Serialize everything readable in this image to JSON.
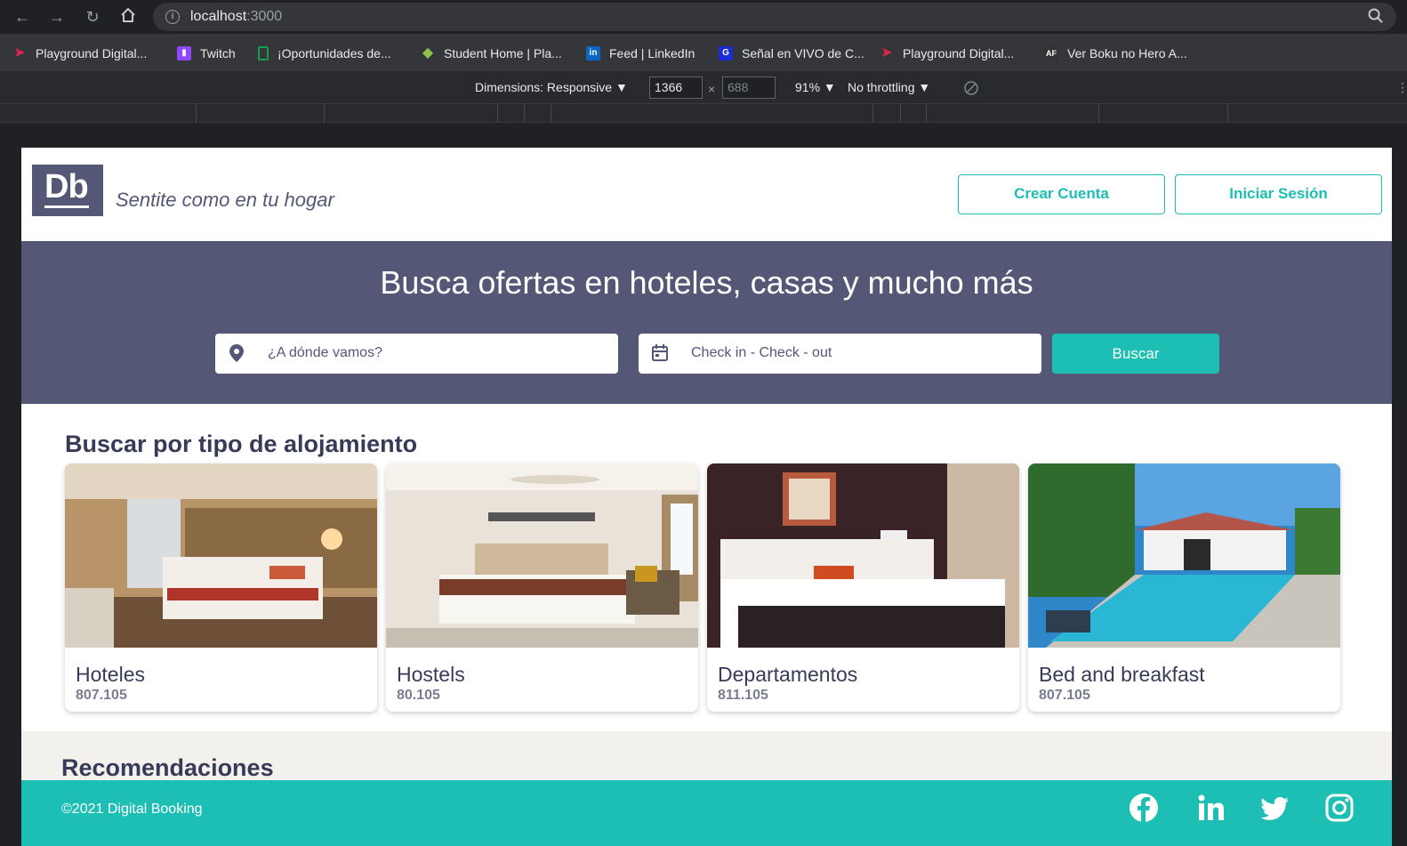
{
  "browser": {
    "url_host": "localhost",
    "url_port": ":3000",
    "bookmarks": [
      {
        "label": "Playground Digital...",
        "color": "#e0244b",
        "icon": "play-icon"
      },
      {
        "label": "Twitch",
        "color": "#9146ff",
        "icon": "twitch-icon"
      },
      {
        "label": "¡Oportunidades de...",
        "color": "#1a9b52",
        "icon": "doc-icon"
      },
      {
        "label": "Student Home | Pla...",
        "color": "#8bc34a",
        "icon": "diamond-icon"
      },
      {
        "label": "Feed | LinkedIn",
        "color": "#0a66c2",
        "icon": "linkedin-icon"
      },
      {
        "label": "Señal en VIVO de C...",
        "color": "#1c2bd6",
        "icon": "g-icon"
      },
      {
        "label": "Playground Digital...",
        "color": "#e0244b",
        "icon": "play-icon"
      },
      {
        "label": "Ver Boku no Hero A...",
        "color": "#333333",
        "icon": "af-icon"
      }
    ],
    "devtools": {
      "dimensions_label": "Dimensions: Responsive ▼",
      "width": "1366",
      "height": "688",
      "times": "×",
      "zoom": "91% ▼",
      "throttling": "No throttling ▼"
    }
  },
  "header": {
    "logo_text": "Db",
    "slogan": "Sentite como en tu hogar",
    "create_account": "Crear Cuenta",
    "login": "Iniciar Sesión"
  },
  "hero": {
    "title": "Busca ofertas en hoteles, casas y mucho más",
    "location_placeholder": "¿A dónde vamos?",
    "dates_placeholder": "Check in - Check - out",
    "search_button": "Buscar"
  },
  "categories": {
    "title": "Buscar por tipo de alojamiento",
    "items": [
      {
        "name": "Hoteles",
        "count": "807.105"
      },
      {
        "name": "Hostels",
        "count": "80.105"
      },
      {
        "name": "Departamentos",
        "count": "811.105"
      },
      {
        "name": "Bed and breakfast",
        "count": "807.105"
      }
    ]
  },
  "recommendations": {
    "title": "Recomendaciones"
  },
  "footer": {
    "copyright": "©2021 Digital Booking",
    "social": [
      "facebook-icon",
      "linkedin-icon",
      "twitter-icon",
      "instagram-icon"
    ]
  },
  "colors": {
    "primary": "#545776",
    "accent": "#1dbeb4",
    "dark_text": "#383b58"
  }
}
